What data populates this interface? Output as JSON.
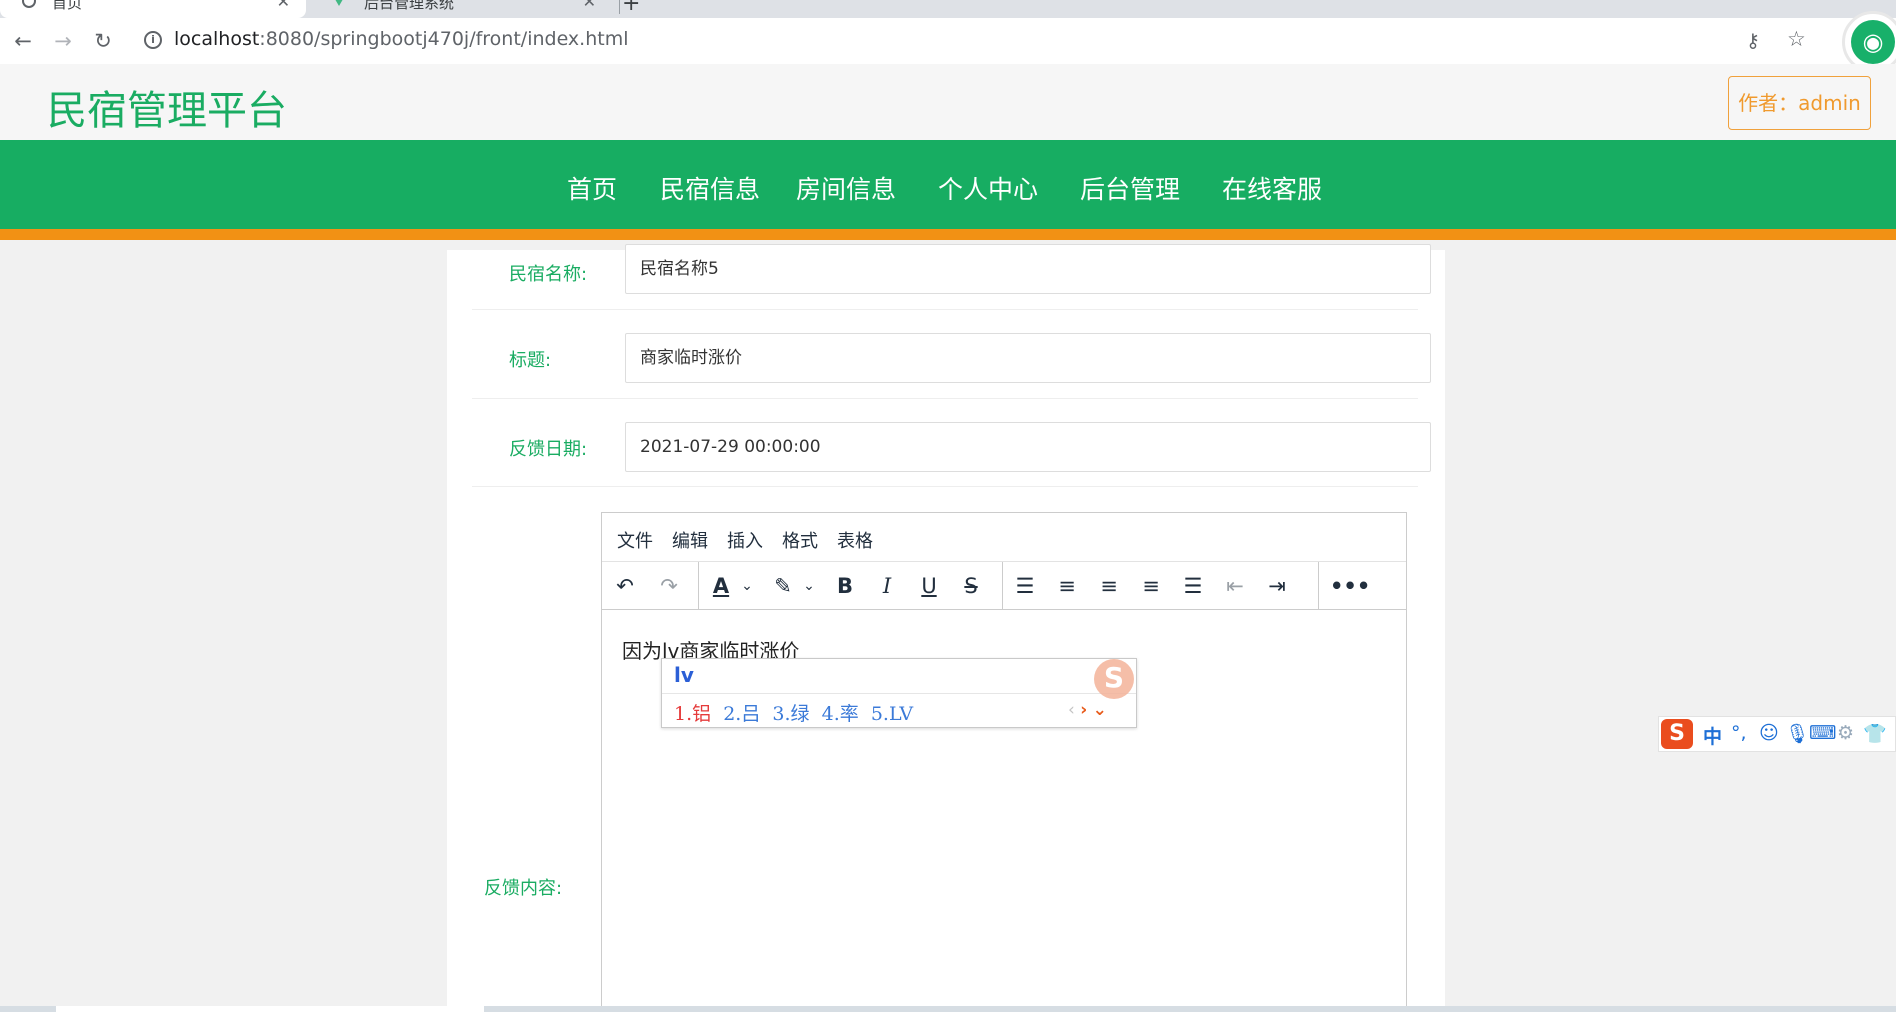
{
  "browser": {
    "tabs": [
      {
        "title": "首页",
        "close": "✕"
      },
      {
        "title": "后台管理系统",
        "close": "✕"
      }
    ],
    "new_tab": "+",
    "url_host": "localhost",
    "url_rest": ":8080/springbootj470j/front/index.html"
  },
  "header": {
    "site_title": "民宿管理平台",
    "author_label": "作者：admin"
  },
  "nav": {
    "items": [
      "首页",
      "民宿信息",
      "房间信息",
      "个人中心",
      "后台管理",
      "在线客服"
    ]
  },
  "form": {
    "homestay_name_label": "民宿名称:",
    "homestay_name_value": "民宿名称5",
    "title_label": "标题:",
    "title_value": "商家临时涨价",
    "date_label": "反馈日期:",
    "date_value": "2021-07-29 00:00:00",
    "content_label": "反馈内容:"
  },
  "editor": {
    "menus": [
      "文件",
      "编辑",
      "插入",
      "格式",
      "表格"
    ],
    "content_text": "因为lv商家临时涨价"
  },
  "ime": {
    "composition": "lv",
    "first_candidate": "1.铝",
    "other_candidates": "  2.吕  3.绿  4.率  5.LV",
    "logo": "S",
    "status_chinese": "中"
  }
}
